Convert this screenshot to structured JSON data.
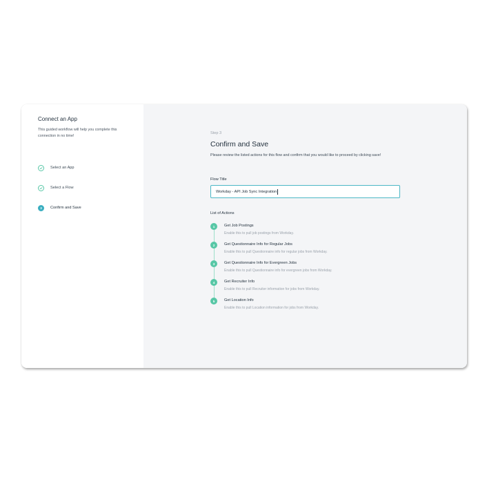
{
  "sidebar": {
    "title": "Connect an App",
    "description": "This guided workflow will help you complete this connection in no time!",
    "steps": [
      {
        "label": "Select an App",
        "status": "done"
      },
      {
        "label": "Select a Flow",
        "status": "done"
      },
      {
        "label": "Confirm and Save",
        "status": "active",
        "number": "3"
      }
    ]
  },
  "main": {
    "step_label": "Step 3",
    "title": "Confirm and Save",
    "description": "Please review the listed actions for this flow and confirm that you would like to proceed by clicking save!",
    "flow_title_label": "Flow Title",
    "flow_title_value": "Workday - API Job Sync Integration",
    "actions_label": "List of Actions",
    "actions": [
      {
        "number": "1",
        "title": "Get Job Postings",
        "description": "Enable this to pull job postings from Workday."
      },
      {
        "number": "2",
        "title": "Get Questionnaire Info for Regular Jobs",
        "description": "Enable this to pull Questionnaire info for regular jobs from Workday."
      },
      {
        "number": "3",
        "title": "Get Questionnaire Info for Evergreen Jobs",
        "description": "Enable this to pull Questionnaire info for evergreen jobs from Workday."
      },
      {
        "number": "4",
        "title": "Get Recruiter Info",
        "description": "Enable this to pull Recruiter information for jobs from Workday."
      },
      {
        "number": "5",
        "title": "Get Location Info",
        "description": "Enable this to pull Location information for jobs from Workday."
      }
    ]
  },
  "colors": {
    "accent_green": "#57c7a6",
    "accent_teal": "#3aaec0",
    "panel_bg": "#f4f5f7"
  }
}
